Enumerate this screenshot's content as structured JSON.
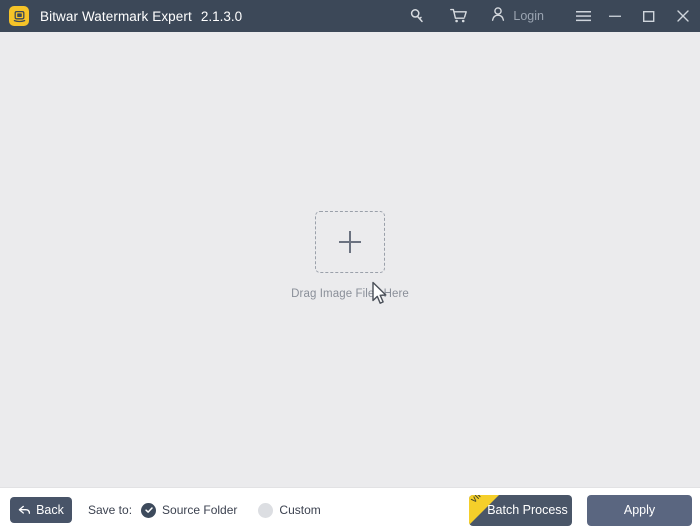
{
  "titlebar": {
    "app_icon_name": "bitwar-app-icon",
    "app_icon_color": "#f5c328",
    "title": "Bitwar Watermark Expert",
    "version": "2.1.3.0",
    "background_color": "#3c4858",
    "actions": {
      "key_icon": "key-icon",
      "cart_icon": "shopping-cart-icon",
      "account_icon": "user-account-icon",
      "login_label": "Login",
      "menu_icon": "hamburger-menu-icon"
    },
    "window_controls": {
      "minimize": "minimize-icon",
      "maximize": "maximize-icon",
      "close": "close-icon"
    }
  },
  "main": {
    "background_color": "#ebebed",
    "dropzone": {
      "plus_icon": "plus-icon",
      "label": "Drag Image Files Here",
      "border_style": "dashed",
      "border_color": "#9aa0aa"
    },
    "cursor": "mouse-pointer-cursor"
  },
  "bottombar": {
    "background_color": "#ffffff",
    "back_label": "Back",
    "back_icon": "back-arrow-icon",
    "save_to_label": "Save to:",
    "save_options": [
      {
        "label": "Source Folder",
        "selected": true
      },
      {
        "label": "Custom",
        "selected": false
      }
    ],
    "batch_label": "Batch Process",
    "batch_badge": "VIP",
    "batch_badge_color": "#f5cf2a",
    "apply_label": "Apply",
    "accent_color": "#4a5668"
  }
}
